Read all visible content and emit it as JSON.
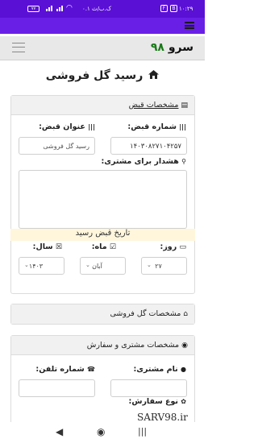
{
  "status": {
    "time": "۱۰:۲۹",
    "speed": "۰.۱ ک.ب/ث",
    "battery": "۷۷",
    "notif_a": "F",
    "notif_b": "B"
  },
  "navbar": {
    "brand_text": "سرو",
    "brand_num": "۹۸"
  },
  "page": {
    "title": "رسید گل فروشی"
  },
  "receipt_section": {
    "header": "مشخصات قبض",
    "receipt_number_label": "شماره قبض:",
    "receipt_number_value": "۱۴۰۳۰۸۲۷۱۰۴۲۵۷",
    "receipt_title_label": "عنوان قبض:",
    "receipt_title_value": "رسید گل فروشی",
    "customer_warning_label": "هشدار برای مشتری:",
    "date_caption": "تاریخ قبض رسید",
    "day_label": "روز:",
    "day_value": "۲۷",
    "month_label": "ماه:",
    "month_value": "آبان",
    "year_label": "سال:",
    "year_value": "۱۴۰۳"
  },
  "shop_section": {
    "header": "مشخصات گل فروشی"
  },
  "customer_section": {
    "header": "مشخصات مشتری و سفارش",
    "customer_name_label": "نام مشتری:",
    "phone_label": "شماره تلفن:",
    "order_type_label": "نوع سفارش:"
  },
  "watermark": "SARV98.ir",
  "icons": {
    "home": "home-icon",
    "receipt": "receipt-icon",
    "barcode": "barcode-icon",
    "pin": "location-pin-icon",
    "calendar": "calendar-icon",
    "user": "user-icon",
    "phone": "phone-icon",
    "palette": "palette-icon"
  },
  "colors": {
    "status_bar": "#5b10d6",
    "top_bar": "#6a1fe6",
    "brand_number": "#1a7a1a",
    "date_bar": "#fff6dc"
  }
}
